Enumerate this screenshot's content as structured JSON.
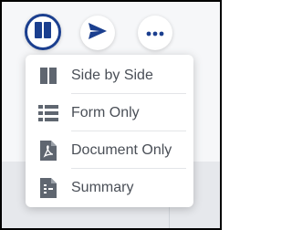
{
  "toolbar": {
    "view_button_icon": "side-by-side-icon",
    "send_button_icon": "send-icon",
    "more_button_icon": "more-horizontal-icon"
  },
  "menu": {
    "items": [
      {
        "label": "Side by Side",
        "icon": "side-by-side-icon"
      },
      {
        "label": "Form Only",
        "icon": "form-list-icon"
      },
      {
        "label": "Document Only",
        "icon": "pdf-document-icon"
      },
      {
        "label": "Summary",
        "icon": "summary-document-icon"
      }
    ]
  },
  "colors": {
    "accent": "#1b3f8f",
    "icon_gray": "#5f6670",
    "text": "#4a4f57"
  }
}
